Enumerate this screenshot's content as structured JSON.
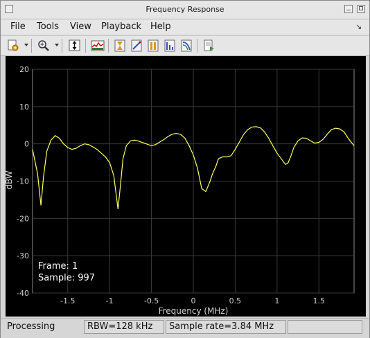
{
  "window": {
    "title": "Frequency Response"
  },
  "menubar": {
    "items": [
      "File",
      "Tools",
      "View",
      "Playback",
      "Help"
    ]
  },
  "toolbar": {
    "icons": [
      "settings-icon",
      "zoom-in-icon",
      "scale-axes-icon",
      "spectrum-settings-icon",
      "cursor-measurements-icon",
      "peak-finder-icon",
      "channel-measurements-icon",
      "distortion-measurements-icon",
      "ccdf-measurements-icon",
      "print-icon"
    ]
  },
  "plot": {
    "frame_label": "Frame: 1",
    "sample_label": "Sample: 997",
    "colors": {
      "background": "#000000",
      "trace": "#ffff66",
      "grid": "#3a3a3a",
      "axis_text": "#d0d0d0"
    }
  },
  "chart_data": {
    "type": "line",
    "xlabel": "Frequency (MHz)",
    "ylabel": "dBW",
    "xlim": [
      -1.92,
      1.92
    ],
    "ylim": [
      -40,
      20
    ],
    "xticks": [
      -1.5,
      -1,
      -0.5,
      0,
      0.5,
      1,
      1.5
    ],
    "xtick_labels": [
      "-1.5",
      "-1",
      "-0.5",
      "0",
      "0.5",
      "1",
      "1.5"
    ],
    "yticks": [
      -40,
      -30,
      -20,
      -10,
      0,
      10,
      20
    ],
    "ytick_labels": [
      "-40",
      "-30",
      "-20",
      "-10",
      "0",
      "10",
      "20"
    ],
    "grid": true,
    "series": [
      {
        "x": [
          -1.92,
          -1.86,
          -1.82,
          -1.79,
          -1.75,
          -1.7,
          -1.65,
          -1.6,
          -1.55,
          -1.5,
          -1.45,
          -1.4,
          -1.35,
          -1.3,
          -1.25,
          -1.2,
          -1.15,
          -1.1,
          -1.05,
          -1.0,
          -0.95,
          -0.9,
          -0.87,
          -0.84,
          -0.8,
          -0.75,
          -0.7,
          -0.65,
          -0.6,
          -0.55,
          -0.5,
          -0.45,
          -0.4,
          -0.35,
          -0.3,
          -0.25,
          -0.2,
          -0.15,
          -0.1,
          -0.05,
          0.0,
          0.05,
          0.1,
          0.15,
          0.2,
          0.23,
          0.27,
          0.3,
          0.35,
          0.4,
          0.45,
          0.5,
          0.55,
          0.6,
          0.65,
          0.7,
          0.75,
          0.8,
          0.85,
          0.9,
          0.95,
          1.0,
          1.05,
          1.1,
          1.13,
          1.17,
          1.2,
          1.25,
          1.3,
          1.35,
          1.4,
          1.45,
          1.5,
          1.55,
          1.6,
          1.65,
          1.7,
          1.75,
          1.8,
          1.85,
          1.92
        ],
        "y": [
          -1.5,
          -8.0,
          -16.5,
          -9.0,
          -2.0,
          1.0,
          2.2,
          1.5,
          0.0,
          -1.0,
          -1.5,
          -1.2,
          -0.5,
          0.0,
          -0.2,
          -0.8,
          -1.5,
          -2.5,
          -3.5,
          -5.0,
          -8.5,
          -17.5,
          -11.0,
          -4.0,
          -0.5,
          0.8,
          1.0,
          0.7,
          0.3,
          -0.1,
          -0.5,
          -0.2,
          0.5,
          1.2,
          2.0,
          2.6,
          2.8,
          2.5,
          1.5,
          -0.5,
          -3.0,
          -6.5,
          -12.0,
          -12.8,
          -10.0,
          -8.0,
          -6.0,
          -4.0,
          -3.5,
          -3.5,
          -3.2,
          -1.5,
          0.5,
          2.5,
          3.8,
          4.5,
          4.6,
          4.3,
          3.2,
          1.5,
          -0.5,
          -2.5,
          -4.0,
          -5.5,
          -5.2,
          -3.0,
          -1.0,
          0.8,
          1.6,
          1.5,
          0.8,
          0.2,
          0.4,
          1.2,
          2.6,
          3.8,
          4.2,
          4.0,
          3.2,
          1.5,
          -0.5
        ]
      }
    ]
  },
  "statusbar": {
    "status": "Processing",
    "rbw": "RBW=128 kHz",
    "sample_rate": "Sample rate=3.84 MHz",
    "extra": ""
  }
}
